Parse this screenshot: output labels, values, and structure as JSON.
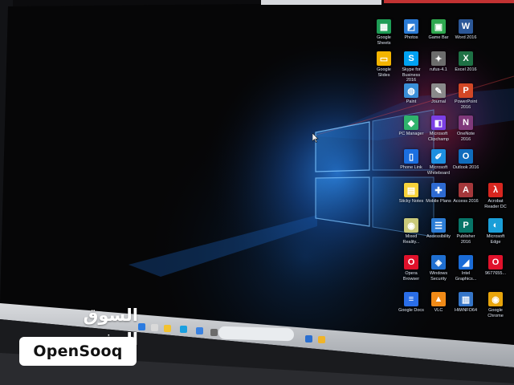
{
  "photo": {
    "subject": "photo of a laptop screen showing the Windows 10 desktop, taken in a dark room",
    "colors": {
      "wallpaper_glow": "#1f7fe8",
      "screen_black": "#060607",
      "bezel": "#c9cbcf",
      "red_light": "#ff3b30"
    }
  },
  "watermark": {
    "arabic": "السوق المفتوح",
    "latin": "OpenSooq"
  },
  "desktop_icons": [
    {
      "label": "Google\nSheets",
      "icon": "sheets-icon",
      "color": "#1e9c55",
      "glyph": "▦"
    },
    {
      "label": "Photos",
      "icon": "photos-icon",
      "color": "#2a7bd6",
      "glyph": "◩"
    },
    {
      "label": "Game Bar",
      "icon": "game-bar-icon",
      "color": "#2fa84f",
      "glyph": "▣"
    },
    {
      "label": "Word 2016",
      "icon": "word-icon",
      "color": "#2b5797",
      "glyph": "W"
    },
    {
      "label": "Google\nSlides",
      "icon": "slides-icon",
      "color": "#f4b400",
      "glyph": "▭"
    },
    {
      "label": "Skype for\nBusiness 2016",
      "icon": "skype-icon",
      "color": "#00a1f1",
      "glyph": "S"
    },
    {
      "label": "rufus-4.1",
      "icon": "rufus-icon",
      "color": "#6c6c6c",
      "glyph": "✦"
    },
    {
      "label": "Excel 2016",
      "icon": "excel-icon",
      "color": "#1e7145",
      "glyph": "X"
    },
    {
      "label": "Paint",
      "icon": "paint-icon",
      "color": "#3a8fd8",
      "glyph": "◍"
    },
    {
      "label": "Journal",
      "icon": "journal-icon",
      "color": "#8a8a8a",
      "glyph": "✎"
    },
    {
      "label": "PowerPoint\n2016",
      "icon": "powerpoint-icon",
      "color": "#d24726",
      "glyph": "P"
    },
    {
      "label": "PC Manager",
      "icon": "pc-manager-icon",
      "color": "#2fb36c",
      "glyph": "◆"
    },
    {
      "label": "Microsoft\nClipchamp",
      "icon": "clipchamp-icon",
      "color": "#7b3fe4",
      "glyph": "◧"
    },
    {
      "label": "OneNote\n2016",
      "icon": "onenote-icon",
      "color": "#80397b",
      "glyph": "N"
    },
    {
      "label": "Phone Link",
      "icon": "phone-link-icon",
      "color": "#1b6fe0",
      "glyph": "▯"
    },
    {
      "label": "Microsoft\nWhiteboard",
      "icon": "whiteboard-icon",
      "color": "#1d8fe0",
      "glyph": "✐"
    },
    {
      "label": "Outlook 2016",
      "icon": "outlook-icon",
      "color": "#0f6cbd",
      "glyph": "O"
    },
    {
      "label": "Sticky Notes",
      "icon": "sticky-notes-icon",
      "color": "#f7d23a",
      "glyph": "▤"
    },
    {
      "label": "Mobile Plans",
      "icon": "mobile-plans-icon",
      "color": "#2e6ad1",
      "glyph": "✚"
    },
    {
      "label": "Access 2016",
      "icon": "access-icon",
      "color": "#a4373a",
      "glyph": "A"
    },
    {
      "label": "Acrobat\nReader DC",
      "icon": "acrobat-icon",
      "color": "#d7261f",
      "glyph": "λ"
    },
    {
      "label": "Mixed\nReality...",
      "icon": "mixed-reality-icon",
      "color": "#c9c97a",
      "glyph": "◉"
    },
    {
      "label": "Accessibility",
      "icon": "accessibility-icon",
      "color": "#2c7dd6",
      "glyph": "☰"
    },
    {
      "label": "Publisher\n2016",
      "icon": "publisher-icon",
      "color": "#077568",
      "glyph": "P"
    },
    {
      "label": "Microsoft\nEdge",
      "icon": "edge-icon",
      "color": "#1a9ed8",
      "glyph": "◐"
    },
    {
      "label": "Opera\nBrowser",
      "icon": "opera-icon",
      "color": "#e0112b",
      "glyph": "O"
    },
    {
      "label": "Windows\nSecurity",
      "icon": "security-icon",
      "color": "#1f6fd1",
      "glyph": "◈"
    },
    {
      "label": "Intel\nGraphics...",
      "icon": "intel-graphics-icon",
      "color": "#1a6bd6",
      "glyph": "◢"
    },
    {
      "label": "9677655...",
      "icon": "opera-file-icon",
      "color": "#e0112b",
      "glyph": "O"
    },
    {
      "label": "Google Docs",
      "icon": "docs-icon",
      "color": "#2a6ee8",
      "glyph": "≡"
    },
    {
      "label": "VLC",
      "icon": "vlc-icon",
      "color": "#f08a17",
      "glyph": "▲"
    },
    {
      "label": "HWiNFO64",
      "icon": "hwinfo-icon",
      "color": "#3575c8",
      "glyph": "▥"
    },
    {
      "label": "Google\nChrome",
      "icon": "chrome-icon",
      "color": "#e8a50c",
      "glyph": "◉"
    }
  ],
  "taskbar": {
    "search_placeholder": "",
    "pinned_icons": [
      "start-icon",
      "task-view-icon",
      "file-explorer-icon",
      "edge-icon",
      "store-icon",
      "settings-icon",
      "mail-icon",
      "files-icon"
    ]
  }
}
